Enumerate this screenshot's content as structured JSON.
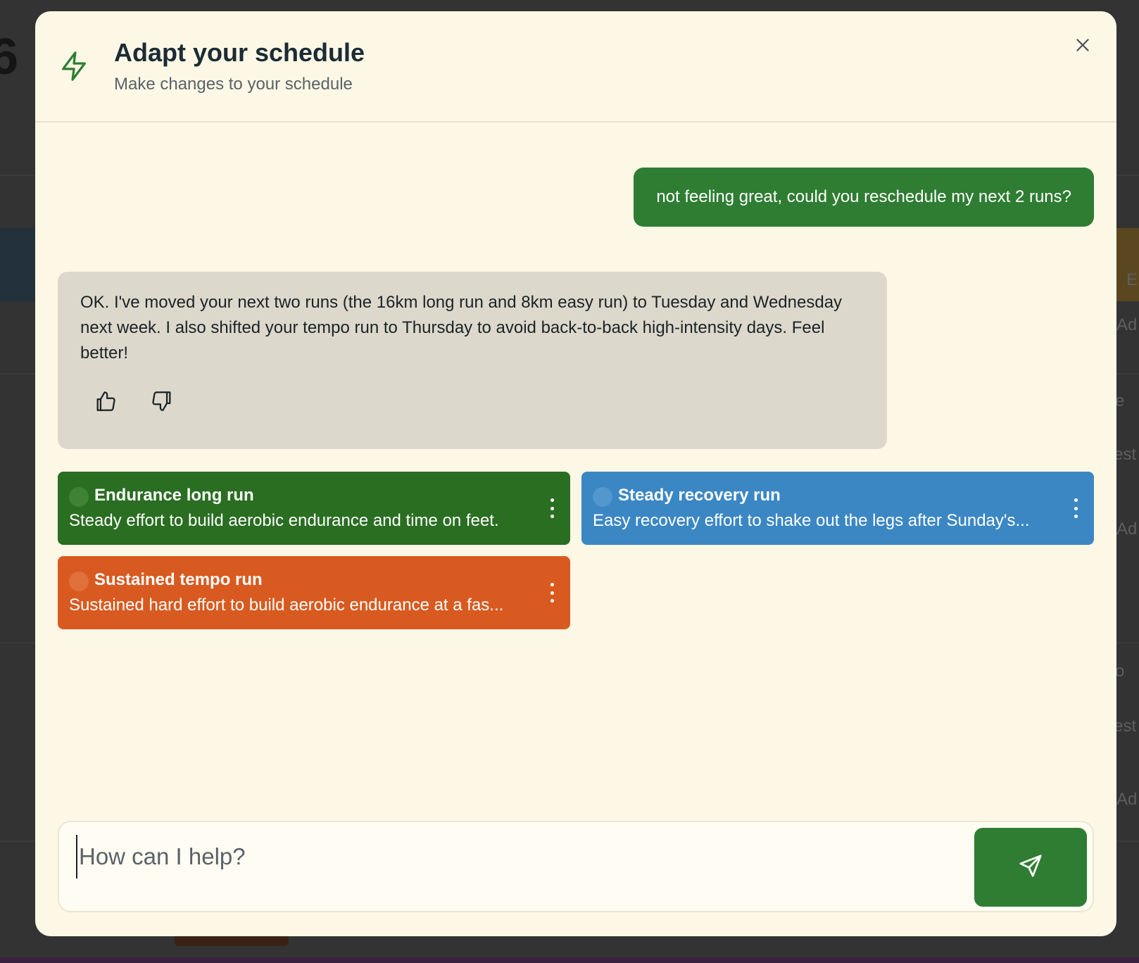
{
  "modal": {
    "title": "Adapt your schedule",
    "subtitle": "Make changes to your schedule",
    "header_icon": "lightning-bolt-icon",
    "close_icon": "close-icon"
  },
  "messages": {
    "user": "not feeling great, could you reschedule my next 2 runs?",
    "assistant": "OK. I've moved your next two runs (the 16km long run and 8km easy run) to Tuesday and Wednesday next week. I also shifted your tempo run to Thursday to avoid back-to-back high-intensity days. Feel better!",
    "feedback_icons": [
      "thumbs-up-icon",
      "thumbs-down-icon"
    ]
  },
  "workouts": [
    {
      "title": "Endurance long run",
      "description": "Steady effort to build aerobic endurance and time on feet.",
      "color": "#2a6e22"
    },
    {
      "title": "Steady recovery run",
      "description": "Easy recovery effort to shake out the legs after Sunday's...",
      "color": "#3b87c4"
    },
    {
      "title": "Sustained tempo run",
      "description": "Sustained hard effort to build aerobic endurance at a fas...",
      "color": "#d95a20"
    }
  ],
  "composer": {
    "placeholder": "How can I help?",
    "send_icon": "send-icon"
  },
  "background": {
    "glyphs": [
      "6",
      "E",
      "Ad",
      "e",
      "est",
      "Ad",
      "o",
      "est",
      "Ad"
    ]
  },
  "colors": {
    "accent": "#2e7d32",
    "modal_bg": "#fdf8e6",
    "assistant_bubble": "#dcd9cc"
  }
}
